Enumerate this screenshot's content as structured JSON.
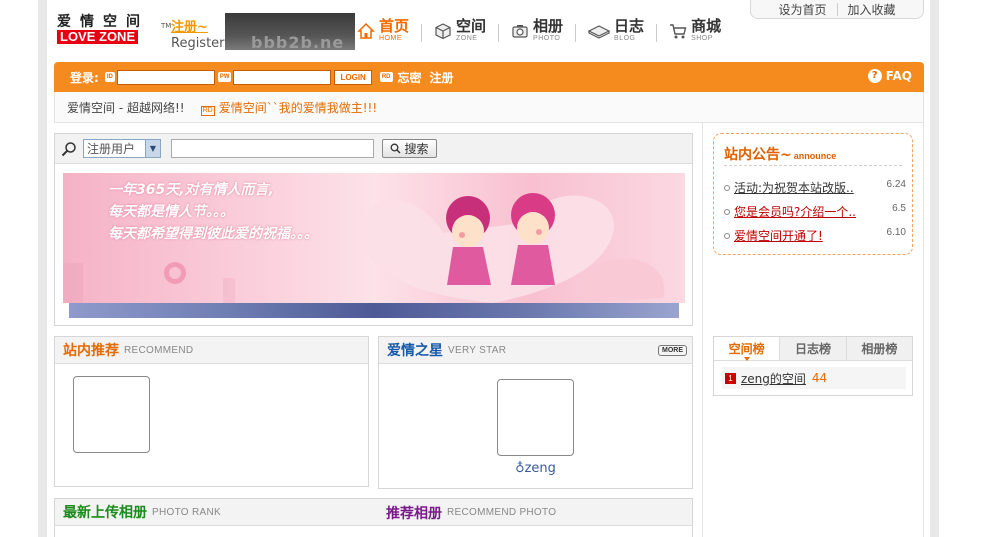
{
  "top_links": [
    "设为首页",
    "加入收藏"
  ],
  "logo": {
    "cn": "爱情空间",
    "en": "LOVE ZONE",
    "tm": "TM"
  },
  "register": {
    "cn": "注册~",
    "en": "Register"
  },
  "banner_dark_text": "bbb2b.ne",
  "nav": [
    {
      "label": "首页",
      "sub": "HOME",
      "icon": "home-icon"
    },
    {
      "label": "空间",
      "sub": "ZONE",
      "icon": "cube-icon"
    },
    {
      "label": "相册",
      "sub": "PHOTO",
      "icon": "camera-icon"
    },
    {
      "label": "日志",
      "sub": "BLOG",
      "icon": "book-icon"
    },
    {
      "label": "商城",
      "sub": "SHOP",
      "icon": "cart-icon"
    }
  ],
  "login": {
    "label": "登录:",
    "id_tag": "ID",
    "pw_tag": "PW",
    "button": "LOGIN",
    "rd": "RD",
    "forgot": "忘密",
    "register": "注册",
    "faq": "FAQ"
  },
  "marquee": {
    "slogan": "爱情空间 - 超越网络!!",
    "rd": "RD",
    "message": "爱情空间``我的爱情我做主!!!"
  },
  "search": {
    "select_value": "注册用户",
    "button": "搜索"
  },
  "banner_lines": [
    "一年365天,对有情人而言,",
    "每天都是情人节。。。",
    "每天都希望得到彼此爱的祝福。。。"
  ],
  "recommend": {
    "title": "站内推荐",
    "sub": "RECOMMEND"
  },
  "star": {
    "title": "爱情之星",
    "sub": "VERY STAR",
    "more": "MORE",
    "user": "♁zeng"
  },
  "latest_album": {
    "title": "最新上传相册",
    "sub": "PHOTO RANK"
  },
  "recommend_album": {
    "title": "推荐相册",
    "sub": "RECOMMEND PHOTO"
  },
  "announce": {
    "title": "站内公告~",
    "sub": "announce",
    "items": [
      {
        "text": "活动:为祝贺本站改版..",
        "date": "6.24",
        "red": false
      },
      {
        "text": "您是会员吗?介绍一个..",
        "date": "6.5",
        "red": true
      },
      {
        "text": "爱情空间开通了!",
        "date": "6.10",
        "red": true
      }
    ]
  },
  "rank": {
    "tabs": [
      "空间榜",
      "日志榜",
      "相册榜"
    ],
    "rows": [
      {
        "num": "1",
        "name": "zeng的空间",
        "score": "44"
      }
    ]
  },
  "colors": {
    "accent": "#f58b1e",
    "announce_border": "#f5a35a",
    "star_title": "#1a5aa8",
    "album_title": "#1a8a1a",
    "recommend_album_title": "#7a1a8a"
  }
}
